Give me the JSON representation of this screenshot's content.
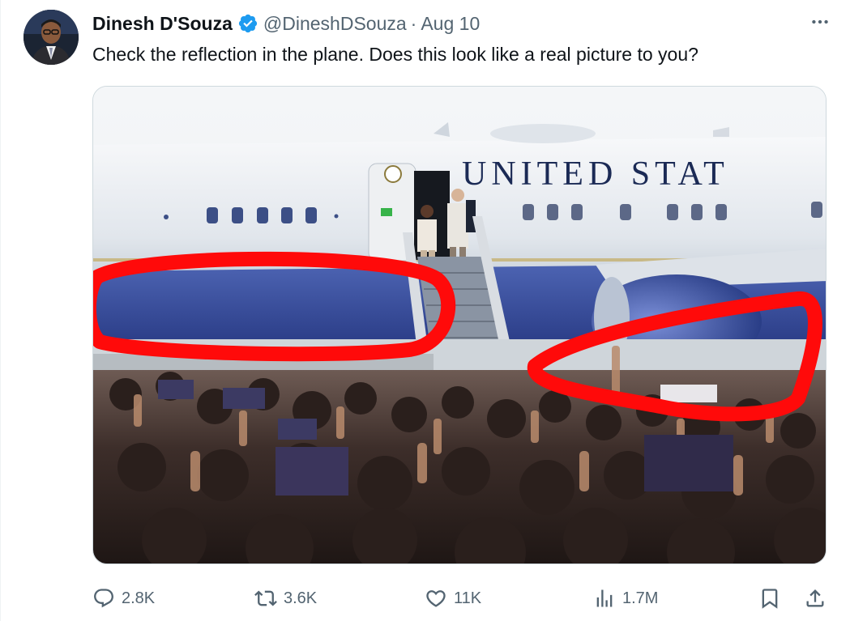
{
  "tweet": {
    "display_name": "Dinesh D'Souza",
    "handle": "@DineshDSouza",
    "separator": "·",
    "date": "Aug 10",
    "text": "Check the reflection in the plane. Does this look like a real picture to you?",
    "media": {
      "plane_lettering": "UNITED STAT",
      "image_description_icon": "photo"
    }
  },
  "actions": {
    "replies": "2.8K",
    "reposts": "3.6K",
    "likes": "11K",
    "views": "1.7M"
  },
  "icons": {
    "verified": "verified-badge-icon",
    "more": "more-icon",
    "reply": "reply-icon",
    "repost": "repost-icon",
    "like": "like-icon",
    "views": "views-icon",
    "bookmark": "bookmark-icon",
    "share": "share-icon"
  },
  "colors": {
    "verified_blue": "#1d9bf0",
    "secondary_text": "#536471",
    "primary_text": "#0f1419",
    "annotation_red": "#ff0a0a"
  }
}
